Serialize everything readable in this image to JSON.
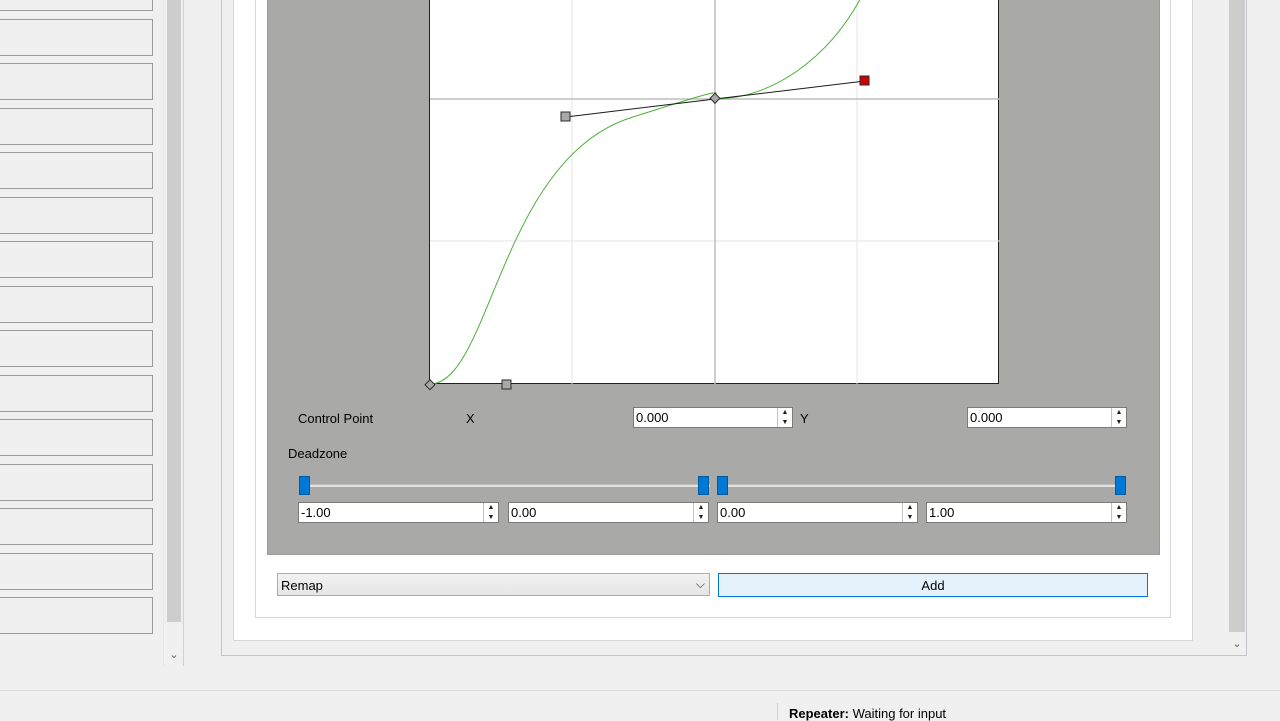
{
  "left_list": {
    "item_count": 15
  },
  "editor": {
    "control_point_label": "Control Point",
    "x_label": "X",
    "y_label": "Y",
    "x_value": "0.000",
    "y_value": "0.000",
    "deadzone_label": "Deadzone",
    "deadzone_values": [
      "-1.00",
      "0.00",
      "0.00",
      "1.00"
    ],
    "curve_color": "#4caf3a",
    "selected_handle_color": "#d10000"
  },
  "footer": {
    "combo_value": "Remap",
    "add_label": "Add"
  },
  "status": {
    "name": "Repeater:",
    "message": "Waiting for input"
  },
  "icons": {
    "spin_up": "▲",
    "spin_down": "▼",
    "chevron_down": "⌵",
    "scroll_down": "⌄"
  }
}
